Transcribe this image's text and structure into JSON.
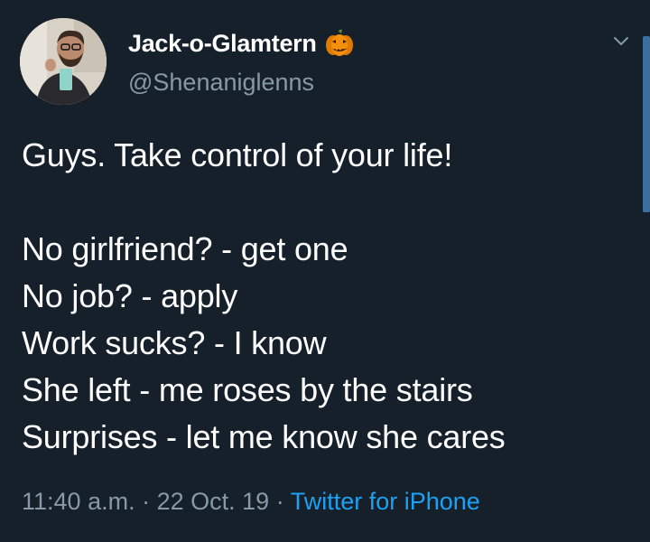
{
  "tweet": {
    "author": {
      "display_name": "Jack-o-Glamtern",
      "handle": "@Shenaniglenns",
      "name_emoji_icon": "jack-o-lantern-icon"
    },
    "text_lines": [
      "Guys. Take control of your life!",
      "",
      "No girlfriend? - get one",
      "No job? - apply",
      "Work sucks? - I know",
      "She left - me roses by the stairs",
      "Surprises - let me know she cares"
    ],
    "time": "11:40 a.m.",
    "date": "22 Oct. 19",
    "separator": "·",
    "source": "Twitter for iPhone"
  },
  "colors": {
    "background": "#15202b",
    "primary_text": "#ffffff",
    "secondary_text": "#8899a6",
    "link": "#1da1f2",
    "pumpkin": "#f4900c"
  }
}
